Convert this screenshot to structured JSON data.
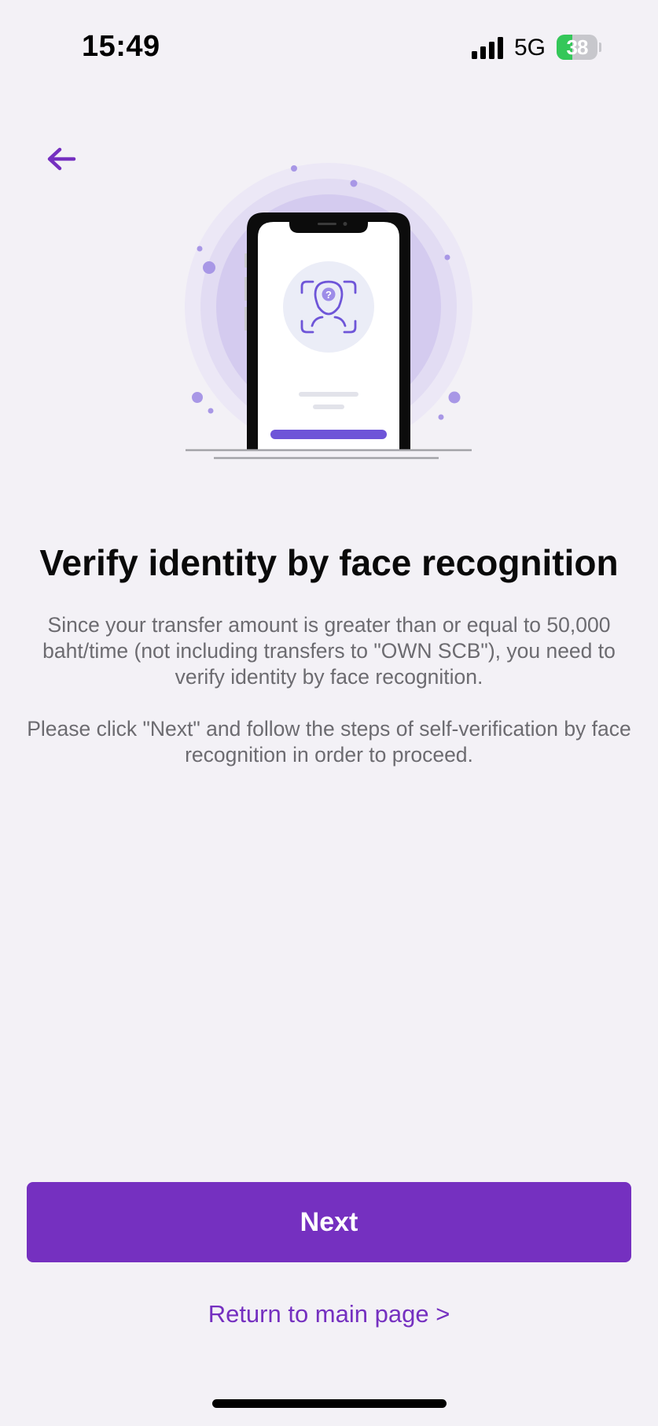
{
  "status_bar": {
    "time": "15:49",
    "network": "5G",
    "battery_level": "38",
    "battery_percent": 38,
    "battery_color": "#34c759"
  },
  "nav": {
    "back_icon": "arrow-left-icon"
  },
  "illustration": {
    "icon": "face-recognition-icon",
    "accent_color": "#6e55d8"
  },
  "content": {
    "title": "Verify identity by face recognition",
    "description_1": "Since your transfer amount is greater than or equal to 50,000 baht/time (not including transfers to \"OWN SCB\"), you need to verify identity by face recognition.",
    "description_2": "Please click \"Next\" and follow the steps of self-verification by face recognition in order to proceed."
  },
  "actions": {
    "next_label": "Next",
    "return_label": "Return to main page >",
    "primary_color": "#7530c0"
  }
}
